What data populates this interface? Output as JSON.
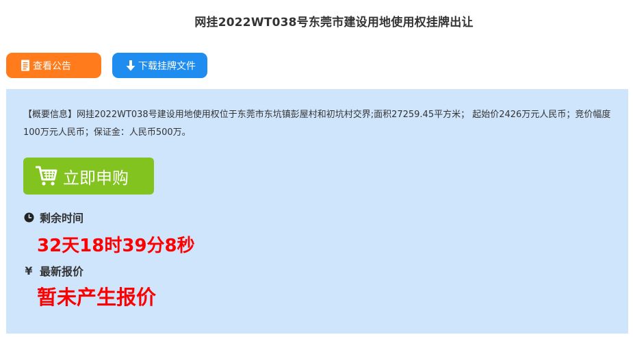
{
  "page": {
    "title": "网挂2022WT038号东莞市建设用地使用权挂牌出让"
  },
  "actions": {
    "notice_label": "查看公告",
    "download_label": "下载挂牌文件"
  },
  "summary": {
    "text": "【概要信息】网挂2022WT038号建设用地使用权位于东莞市东坑镇彭屋村和初坑村交界;面积27259.45平方米； 起始价2426万元人民币；竞价幅度100万元人民币；保证金：人民币500万。"
  },
  "buy": {
    "label": "立即申购"
  },
  "remaining": {
    "label": "剩余时间",
    "value": "32天18时39分8秒"
  },
  "latest_offer": {
    "symbol": "¥",
    "label": "最新报价",
    "value": "暂未产生报价"
  },
  "colors": {
    "notice_button": "#ff7b1c",
    "download_button": "#1f8cf0",
    "buy_button": "#82c31f",
    "panel_background": "#cfe5fc",
    "highlight": "#ff0000"
  },
  "icons": {
    "notice": "document-icon",
    "download": "download-arrow-icon",
    "buy": "cart-icon",
    "remaining": "clock-icon",
    "latest_offer": "yen-icon"
  }
}
